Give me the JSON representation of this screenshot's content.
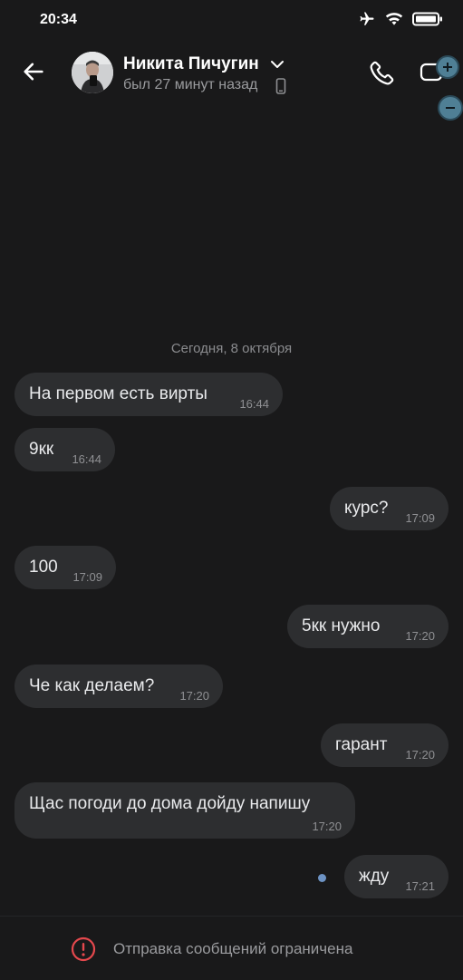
{
  "status_bar": {
    "time": "20:34"
  },
  "header": {
    "name": "Никита Пичугин",
    "last_seen": "был 27 минут назад"
  },
  "chat": {
    "date_separator": "Сегодня, 8 октября",
    "messages": [
      {
        "direction": "incoming",
        "text": "На первом есть вирты",
        "time": "16:44"
      },
      {
        "direction": "incoming",
        "text": "9кк",
        "time": "16:44"
      },
      {
        "direction": "outgoing",
        "text": "курс?",
        "time": "17:09"
      },
      {
        "direction": "incoming",
        "text": "100",
        "time": "17:09"
      },
      {
        "direction": "outgoing",
        "text": "5кк нужно",
        "time": "17:20"
      },
      {
        "direction": "incoming",
        "text": "Че как делаем?",
        "time": "17:20"
      },
      {
        "direction": "outgoing",
        "text": "гарант",
        "time": "17:20"
      },
      {
        "direction": "incoming",
        "text": "Щас погоди до дома дойду напишу",
        "time": "17:20"
      },
      {
        "direction": "outgoing",
        "text": "жду",
        "time": "17:21",
        "unread": true
      }
    ]
  },
  "footer": {
    "restriction_text": "Отправка сообщений ограничена"
  },
  "colors": {
    "background": "#19191a",
    "bubble": "#2d2e30",
    "unread_dot": "#6d93c4",
    "warning": "#e5484d"
  }
}
